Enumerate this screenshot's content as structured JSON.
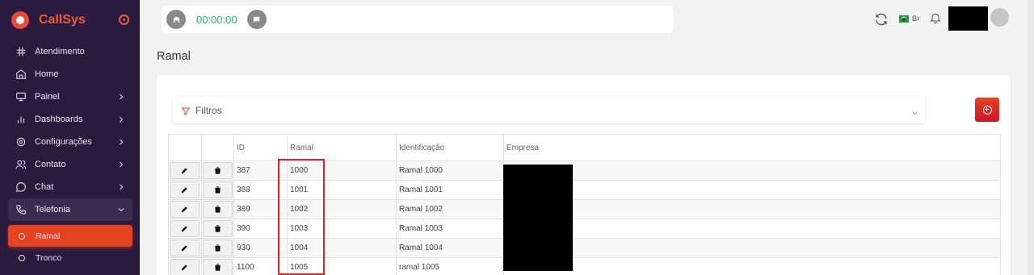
{
  "app": {
    "name": "CallSys"
  },
  "sidebar": {
    "items": [
      {
        "label": "Atendimento",
        "icon": "slack-icon"
      },
      {
        "label": "Home",
        "icon": "home-icon"
      },
      {
        "label": "Painel",
        "icon": "monitor-icon",
        "has_children": true
      },
      {
        "label": "Dashboards",
        "icon": "bar-chart-icon",
        "has_children": true
      },
      {
        "label": "Configurações",
        "icon": "settings-icon",
        "has_children": true
      },
      {
        "label": "Contato",
        "icon": "users-icon",
        "has_children": true
      },
      {
        "label": "Chat",
        "icon": "message-circle-icon",
        "has_children": true
      },
      {
        "label": "Telefonia",
        "icon": "phone-icon",
        "expanded": true
      }
    ],
    "telefonia_children": [
      {
        "label": "Ramal",
        "active": true
      },
      {
        "label": "Tronco",
        "active": false
      }
    ]
  },
  "call_bar": {
    "timer": "00:00:00"
  },
  "header": {
    "language": "Br"
  },
  "page": {
    "title": "Ramal"
  },
  "filters": {
    "label": "Filtros"
  },
  "table": {
    "columns": [
      "",
      "",
      "ID",
      "Ramal",
      "Identificação",
      "Empresa"
    ],
    "rows": [
      {
        "id": "387",
        "ramal": "1000",
        "identificacao": "Ramal 1000",
        "empresa": ""
      },
      {
        "id": "388",
        "ramal": "1001",
        "identificacao": "Ramal 1001",
        "empresa": ""
      },
      {
        "id": "389",
        "ramal": "1002",
        "identificacao": "Ramal 1002",
        "empresa": ""
      },
      {
        "id": "390",
        "ramal": "1003",
        "identificacao": "Ramal 1003",
        "empresa": ""
      },
      {
        "id": "930",
        "ramal": "1004",
        "identificacao": "Ramal 1004",
        "empresa": ""
      },
      {
        "id": "1100",
        "ramal": "1005",
        "identificacao": "ramal 1005",
        "empresa": ""
      }
    ]
  },
  "colors": {
    "sidebar_bg": "#2a1a3e",
    "accent": "#e5421f",
    "timer": "#22b573",
    "highlight_box": "#e02424"
  }
}
